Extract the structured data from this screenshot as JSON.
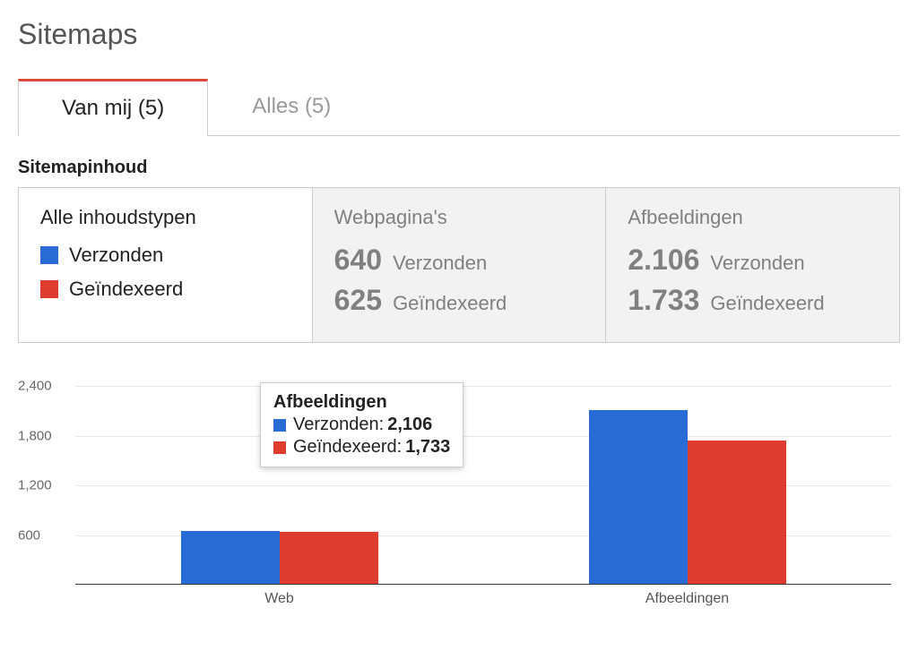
{
  "page_title": "Sitemaps",
  "tabs": [
    {
      "label": "Van mij (5)",
      "active": true
    },
    {
      "label": "Alles (5)",
      "active": false
    }
  ],
  "section_title": "Sitemapinhoud",
  "colors": {
    "submitted": "#2a6cd6",
    "indexed": "#de3c2f"
  },
  "legend": {
    "title": "Alle inhoudstypen",
    "submitted": "Verzonden",
    "indexed": "Geïndexeerd"
  },
  "tiles": [
    {
      "title": "Webpagina's",
      "submitted_value": "640",
      "submitted_label": "Verzonden",
      "indexed_value": "625",
      "indexed_label": "Geïndexeerd"
    },
    {
      "title": "Afbeeldingen",
      "submitted_value": "2.106",
      "submitted_label": "Verzonden",
      "indexed_value": "1.733",
      "indexed_label": "Geïndexeerd"
    }
  ],
  "tooltip": {
    "title": "Afbeeldingen",
    "rows": [
      {
        "label": "Verzonden",
        "value": "2,106"
      },
      {
        "label": "Geïndexeerd",
        "value": "1,733"
      }
    ]
  },
  "chart_data": {
    "type": "bar",
    "title": "",
    "xlabel": "",
    "ylabel": "",
    "ylim": [
      0,
      2600
    ],
    "yticks": [
      600,
      1200,
      1800,
      2400
    ],
    "categories": [
      "Web",
      "Afbeeldingen"
    ],
    "series": [
      {
        "name": "Verzonden",
        "color": "#2a6cd6",
        "values": [
          640,
          2106
        ]
      },
      {
        "name": "Geïndexeerd",
        "color": "#de3c2f",
        "values": [
          625,
          1733
        ]
      }
    ]
  }
}
